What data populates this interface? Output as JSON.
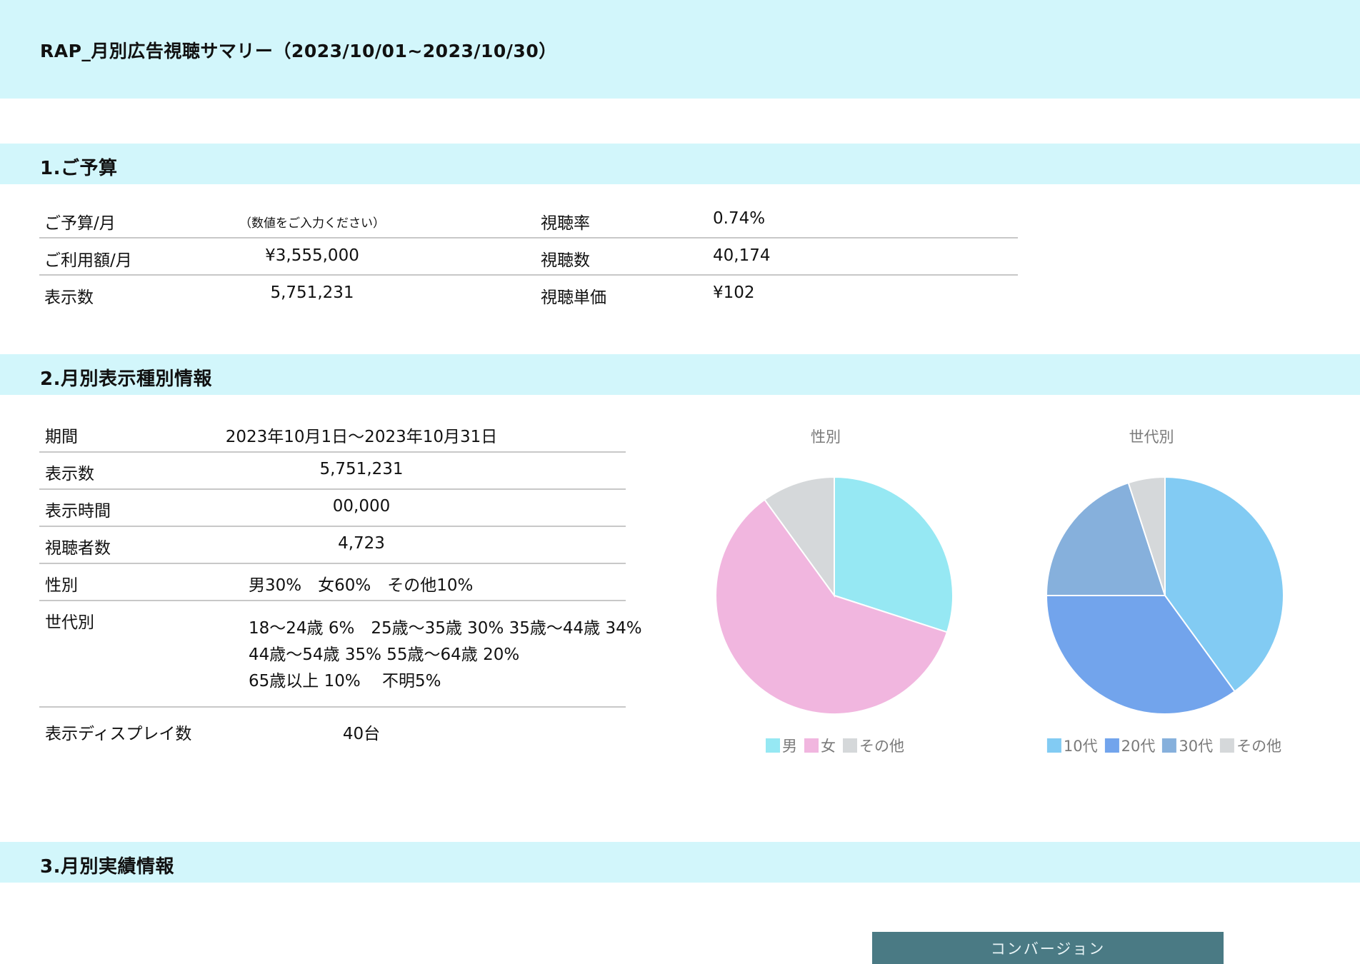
{
  "header": {
    "title": "RAP_月別広告視聴サマリー（2023/10/01~2023/10/30）"
  },
  "section1": {
    "title": "1.ご予算",
    "budget_label": "ご予算/月",
    "budget_value": "（数値をご入力ください）",
    "usage_label": "ご利用額/月",
    "usage_value": "¥3,555,000",
    "impressions_label": "表示数",
    "impressions_value": "5,751,231",
    "view_rate_label": "視聴率",
    "view_rate_value": "0.74%",
    "views_label": "視聴数",
    "views_value": "40,174",
    "unit_price_label": "視聴単価",
    "unit_price_value": "¥102"
  },
  "section2": {
    "title": "2.月別表示種別情報",
    "period_label": "期間",
    "period_value": "2023年10月1日〜2023年10月31日",
    "impressions_label": "表示数",
    "impressions_value": "5,751,231",
    "display_time_label": "表示時間",
    "display_time_value": "00,000",
    "viewers_label": "視聴者数",
    "viewers_value": "4,723",
    "gender_label": "性別",
    "gender_value": "男30%　女60%　その他10%",
    "generation_label": "世代別",
    "generation_lines": [
      "18〜24歳 6%　25歳〜35歳 30%  35歳〜44歳 34%",
      "44歳〜54歳 35%  55歳〜64歳 20%",
      "65歳以上 10%　 不明5%"
    ],
    "displays_label": "表示ディスプレイ数",
    "displays_value": "40台"
  },
  "chart_data": [
    {
      "type": "pie",
      "title": "性別",
      "categories": [
        "男",
        "女",
        "その他"
      ],
      "values": [
        30,
        60,
        10
      ],
      "colors": [
        "#96e8f3",
        "#f1b6df",
        "#d5d8da"
      ],
      "legend": "bottom"
    },
    {
      "type": "pie",
      "title": "世代別",
      "categories": [
        "10代",
        "20代",
        "30代",
        "その他"
      ],
      "values": [
        40,
        35,
        20,
        5
      ],
      "colors": [
        "#82cbf3",
        "#72a4ec",
        "#86b0dc",
        "#d5d8da"
      ],
      "legend": "bottom"
    }
  ],
  "section3": {
    "title": "3.月別実績情報",
    "conversion_label": "コンバージョン"
  }
}
